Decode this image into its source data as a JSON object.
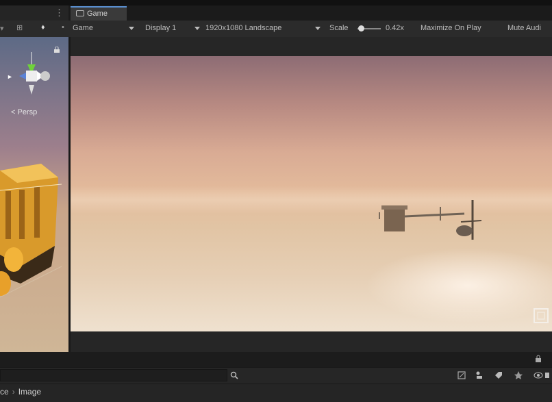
{
  "tab": {
    "label": "Game"
  },
  "toolbar": {
    "view_mode": "Game",
    "display": "Display 1",
    "resolution": "1920x1080 Landscape",
    "scale_label": "Scale",
    "scale_value": "0.42x",
    "maximize_on_play": "Maximize On Play",
    "mute_audio": "Mute Audi"
  },
  "scene_view": {
    "persp_label": "< Persp"
  },
  "breadcrumb": {
    "parent": "ce",
    "current": "Image"
  },
  "colors": {
    "accent": "#5a8fd0",
    "panel": "#2b2b2b",
    "sky_top": "#8d6c74",
    "ground": "#e6cfb5"
  },
  "icons": [
    "game-view-icon",
    "gizmo-icon",
    "lock-icon",
    "search-icon",
    "fullscreen-icon",
    "scene-tool-icons"
  ]
}
